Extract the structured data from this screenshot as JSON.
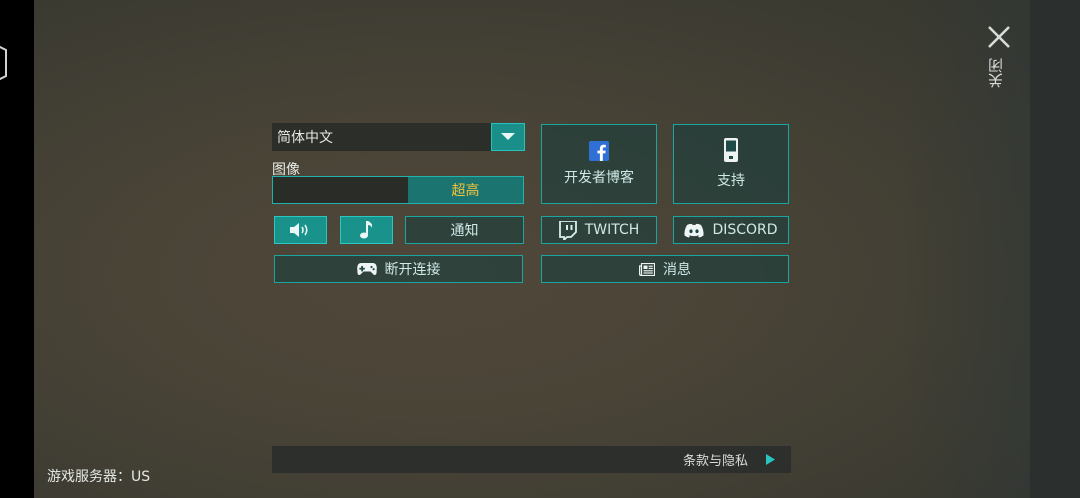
{
  "close": {
    "label": "关闭",
    "icon": "close-icon"
  },
  "language": {
    "selected": "简体中文",
    "icon": "dropdown-arrow-icon"
  },
  "graphics": {
    "label": "图像",
    "value": "超高",
    "level_fraction": 0.46,
    "value_color": "#f2c33a"
  },
  "buttons": {
    "dev_blog": {
      "label": "开发者博客",
      "icon": "facebook-icon"
    },
    "support": {
      "label": "支持",
      "icon": "phone-icon"
    },
    "sound": {
      "icon": "speaker-icon"
    },
    "music": {
      "icon": "music-note-icon"
    },
    "notify": {
      "label": "通知"
    },
    "twitch": {
      "label": "TWITCH",
      "icon": "twitch-icon"
    },
    "discord": {
      "label": "DISCORD",
      "icon": "discord-icon"
    },
    "disconnect": {
      "label": "断开连接",
      "icon": "gamepad-icon"
    },
    "news": {
      "label": "消息",
      "icon": "news-icon"
    }
  },
  "footer": {
    "terms": "条款与隐私",
    "server": "游戏服务器：US"
  },
  "colors": {
    "accent": "#1aa6a0",
    "accent_fill": "#1a8f8a"
  }
}
